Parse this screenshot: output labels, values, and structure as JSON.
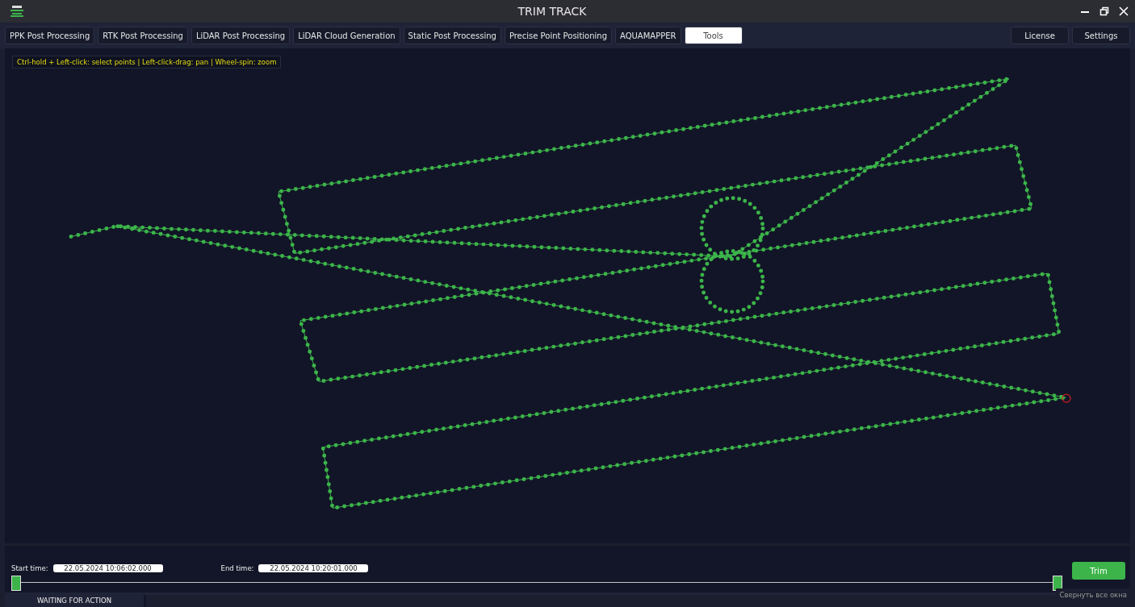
{
  "window": {
    "title": "TRIM TRACK"
  },
  "tabs": [
    {
      "label": "PPK Post Processing",
      "selected": false
    },
    {
      "label": "RTK Post Processing",
      "selected": false
    },
    {
      "label": "LiDAR Post Processing",
      "selected": false
    },
    {
      "label": "LiDAR Cloud Generation",
      "selected": false
    },
    {
      "label": "Static Post Processing",
      "selected": false
    },
    {
      "label": "Precise Point Positioning",
      "selected": false
    },
    {
      "label": "AQUAMAPPER",
      "selected": false
    },
    {
      "label": "Tools",
      "selected": true
    }
  ],
  "right_buttons": [
    "License",
    "Settings"
  ],
  "hint": "Ctrl-hold + Left-click: select points | Left-click-drag: pan | Wheel-spin: zoom",
  "start_time": {
    "label": "Start time:",
    "value": "22.05.2024 10:06:02.000"
  },
  "end_time": {
    "label": "End time:",
    "value": "22.05.2024 10:20:01.000"
  },
  "range": {
    "start": {
      "level": 0
    },
    "end": {
      "level": 1
    }
  },
  "trim_button": "Trim",
  "status": "WAITING FOR ACTION",
  "tooltip": "Свернуть все окна"
}
